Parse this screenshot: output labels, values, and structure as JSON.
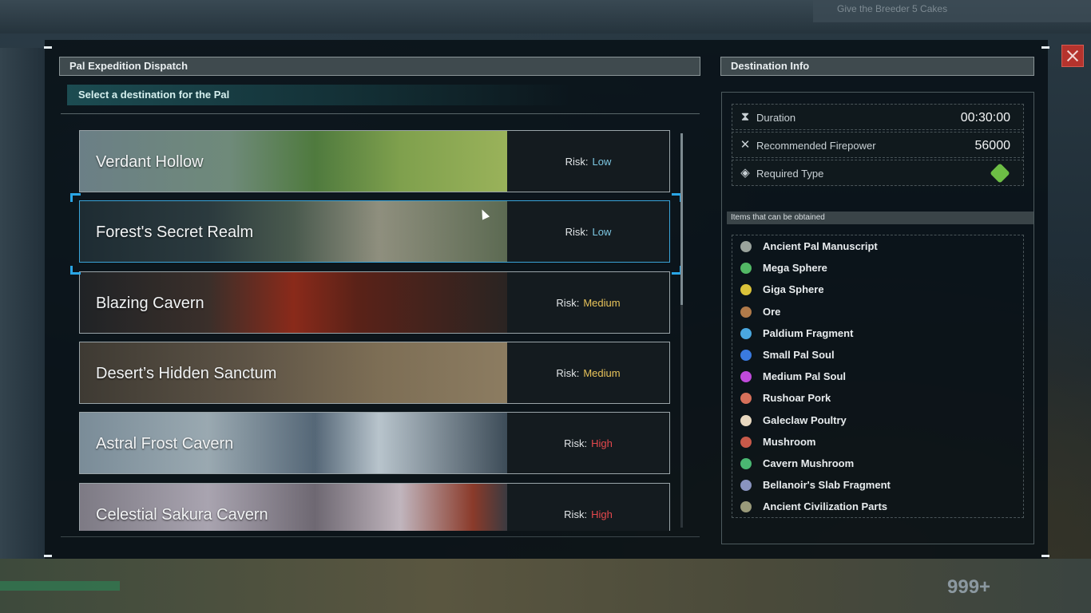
{
  "background": {
    "quest_text": "Give the Breeder 5 Cakes",
    "bottom_count": "999+"
  },
  "dispatch_panel": {
    "title": "Pal Expedition Dispatch",
    "subtitle": "Select a destination for the Pal",
    "risk_label": "Risk:",
    "destinations": [
      {
        "name": "Verdant Hollow",
        "risk": "Low",
        "risk_color": "#7ec8e3",
        "img_gradient": "linear-gradient(90deg,#6b7f86 0%,#6f8a7a 35%,#4f7a3e 55%,#7fa04d 75%,#9ab25a 100%)"
      },
      {
        "name": "Forest's Secret Realm",
        "risk": "Low",
        "risk_color": "#7ec8e3",
        "img_gradient": "linear-gradient(90deg,#1e2c33 0%,#2b3a3e 30%,#4a5a4e 50%,#8f8f7e 70%,#5c6a52 100%)"
      },
      {
        "name": "Blazing Cavern",
        "risk": "Medium",
        "risk_color": "#e8c35a",
        "img_gradient": "linear-gradient(90deg,#202326 0%,#3a2f2a 30%,#8a2a1a 50%,#5a2218 65%,#2a2422 100%)"
      },
      {
        "name": "Desert’s Hidden Sanctum",
        "risk": "Medium",
        "risk_color": "#e8c35a",
        "img_gradient": "linear-gradient(90deg,#3e3a33 0%,#5e5446 40%,#7d6e55 70%,#8c7c61 100%)"
      },
      {
        "name": "Astral Frost Cavern",
        "risk": "High",
        "risk_color": "#e5484d",
        "img_gradient": "linear-gradient(90deg,#7a8c98 0%,#9aa9b1 30%,#556777 55%,#b8c4cc 70%,#3d4c58 100%)"
      },
      {
        "name": "Celestial Sakura Cavern",
        "risk": "High",
        "risk_color": "#e5484d",
        "img_gradient": "linear-gradient(90deg,#7d7a84 0%,#a9a4b0 30%,#6e6872 55%,#c0b5bd 75%,#8a3a2a 92%,#3b3a40 100%)"
      }
    ]
  },
  "info_panel": {
    "title": "Destination Info",
    "duration_label": "Duration",
    "duration_value": "00:30:00",
    "firepower_label": "Recommended Firepower",
    "firepower_value": "56000",
    "type_label": "Required Type",
    "type_icon": "grass-type-icon",
    "type_color": "#6dbe45",
    "items_header": "Items that can be obtained",
    "items": [
      {
        "name": "Ancient Pal Manuscript",
        "icon": "manuscript-icon",
        "color": "#9aa39c"
      },
      {
        "name": "Mega Sphere",
        "icon": "mega-sphere-icon",
        "color": "#52b865"
      },
      {
        "name": "Giga Sphere",
        "icon": "giga-sphere-icon",
        "color": "#d9c23a"
      },
      {
        "name": "Ore",
        "icon": "ore-icon",
        "color": "#b07a4a"
      },
      {
        "name": "Paldium Fragment",
        "icon": "paldium-icon",
        "color": "#4aa8e0"
      },
      {
        "name": "Small Pal Soul",
        "icon": "small-soul-icon",
        "color": "#3a7ae0"
      },
      {
        "name": "Medium Pal Soul",
        "icon": "medium-soul-icon",
        "color": "#c04adb"
      },
      {
        "name": "Rushoar Pork",
        "icon": "pork-icon",
        "color": "#d6705a"
      },
      {
        "name": "Galeclaw Poultry",
        "icon": "poultry-icon",
        "color": "#e8d8c0"
      },
      {
        "name": "Mushroom",
        "icon": "mushroom-icon",
        "color": "#c85a4a"
      },
      {
        "name": "Cavern Mushroom",
        "icon": "cavern-mushroom-icon",
        "color": "#4ab872"
      },
      {
        "name": "Bellanoir's Slab Fragment",
        "icon": "slab-icon",
        "color": "#8a94c0"
      },
      {
        "name": "Ancient Civilization Parts",
        "icon": "civilization-parts-icon",
        "color": "#9a9a7a"
      }
    ]
  }
}
